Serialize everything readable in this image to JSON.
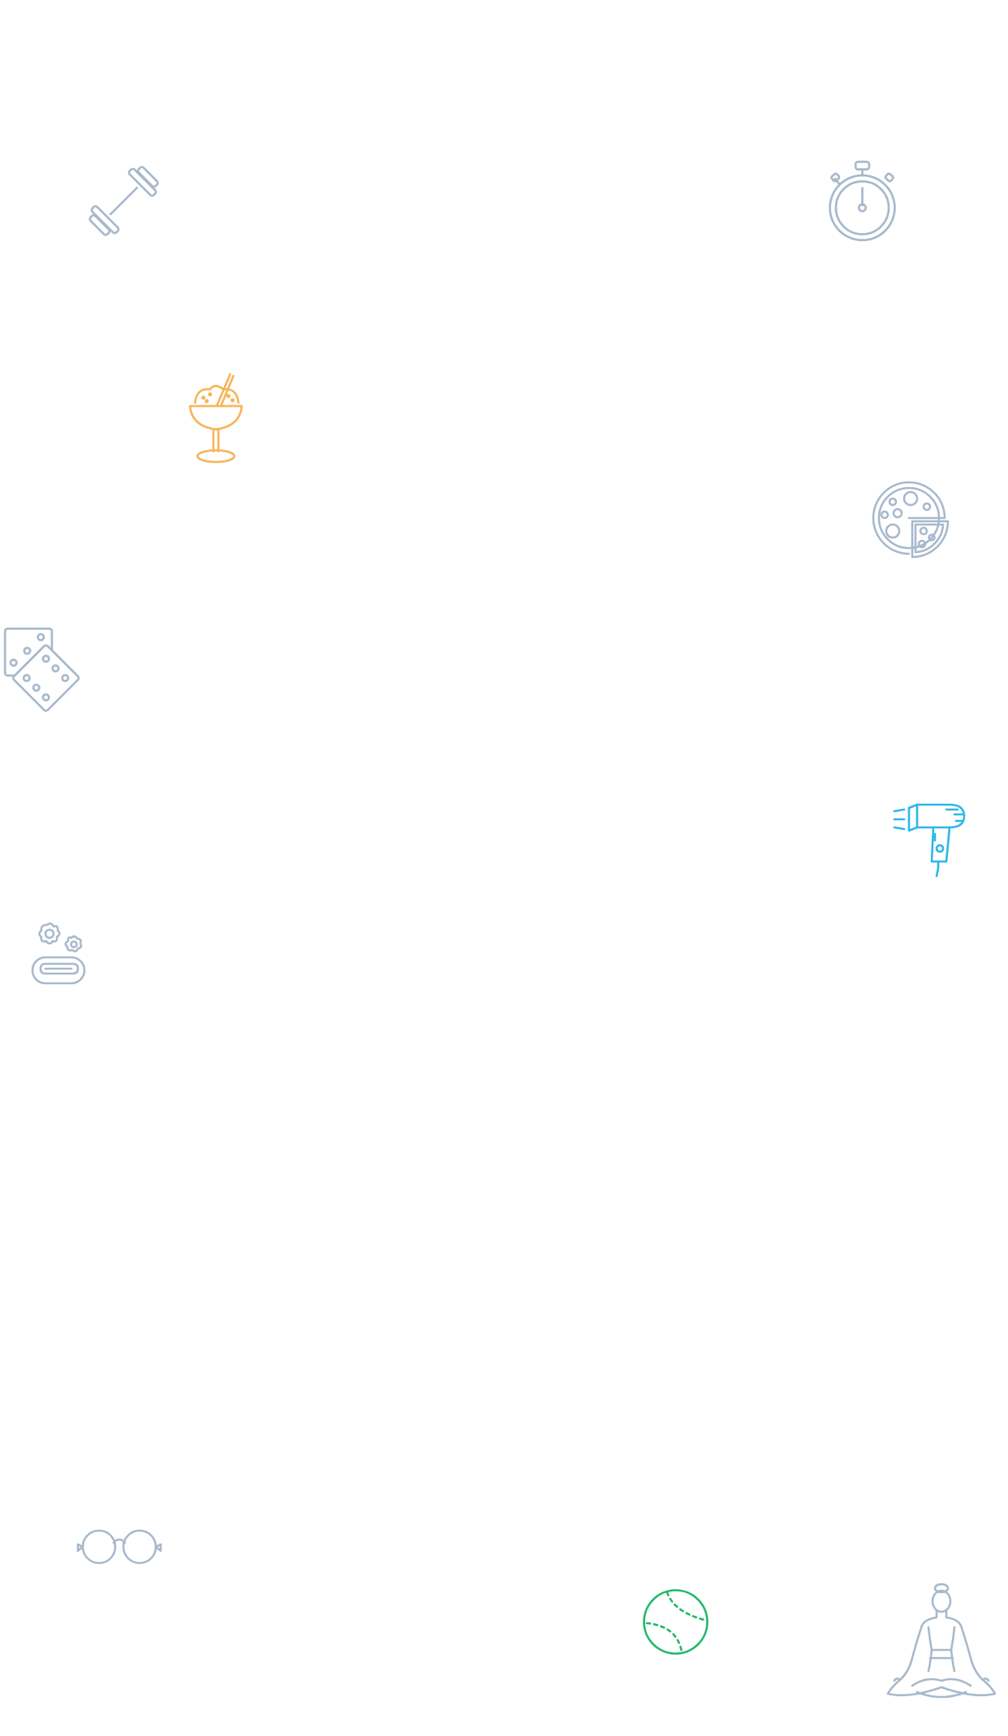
{
  "background_color": "#ffffff",
  "colors": {
    "icon_gray": "#a7b9cc",
    "icon_orange": "#f7b55b",
    "icon_blue": "#2bb8e8",
    "icon_green": "#1fb86a"
  },
  "icons": [
    {
      "name": "dumbbell-icon",
      "color": "icon_gray"
    },
    {
      "name": "stopwatch-icon",
      "color": "icon_gray"
    },
    {
      "name": "ice-cream-sundae-icon",
      "color": "icon_orange"
    },
    {
      "name": "pizza-icon",
      "color": "icon_gray"
    },
    {
      "name": "dice-icon",
      "color": "icon_gray"
    },
    {
      "name": "hair-dryer-icon",
      "color": "icon_blue"
    },
    {
      "name": "bath-towel-icon",
      "color": "icon_gray"
    },
    {
      "name": "eyeglasses-icon",
      "color": "icon_gray"
    },
    {
      "name": "baseball-icon",
      "color": "icon_green"
    },
    {
      "name": "yoga-meditation-icon",
      "color": "icon_gray"
    }
  ]
}
